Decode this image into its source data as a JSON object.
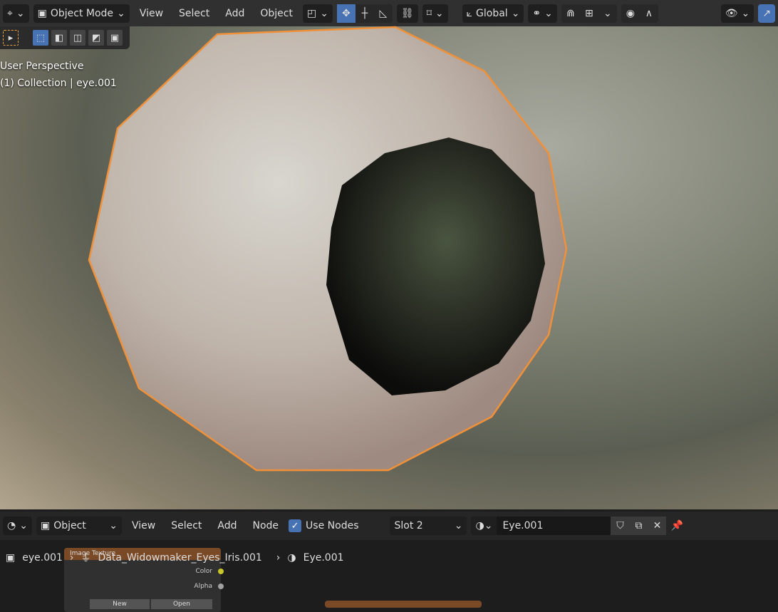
{
  "top_header": {
    "mode": "Object Mode",
    "menus": [
      "View",
      "Select",
      "Add",
      "Object"
    ],
    "orientation": "Global"
  },
  "viewport": {
    "perspective": "User Perspective",
    "collection": "(1) Collection | eye.001"
  },
  "node_header": {
    "mode": "Object",
    "menus": [
      "View",
      "Select",
      "Add",
      "Node"
    ],
    "use_nodes": "Use Nodes",
    "use_nodes_checked": true,
    "slot": "Slot 2",
    "material": "Eye.001"
  },
  "breadcrumb": {
    "object": "eye.001",
    "mesh": "Data_Widowmaker_Eyes_Iris.001",
    "material": "Eye.001"
  },
  "node": {
    "title": "Image Texture",
    "outputs": [
      "Color",
      "Alpha"
    ],
    "new": "New",
    "open": "Open"
  },
  "colors": {
    "selection": "#f0913a",
    "accent": "#4772b3"
  }
}
